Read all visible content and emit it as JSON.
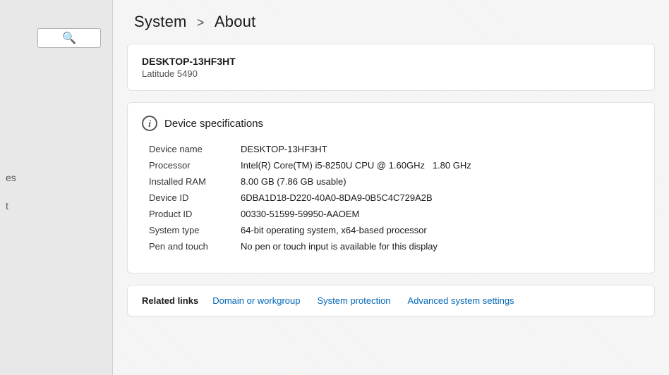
{
  "breadcrumb": {
    "parent": "System",
    "separator": ">",
    "current": "About"
  },
  "device_header": {
    "hostname": "DESKTOP-13HF3HT",
    "model": "Latitude 5490"
  },
  "specs_section": {
    "icon_label": "i",
    "title": "Device specifications",
    "rows": [
      {
        "label": "Device name",
        "value": "DESKTOP-13HF3HT"
      },
      {
        "label": "Processor",
        "value": "Intel(R) Core(TM) i5-8250U CPU @ 1.60GHz   1.80 GHz"
      },
      {
        "label": "Installed RAM",
        "value": "8.00 GB (7.86 GB usable)"
      },
      {
        "label": "Device ID",
        "value": "6DBA1D18-D220-40A0-8DA9-0B5C4C729A2B"
      },
      {
        "label": "Product ID",
        "value": "00330-51599-59950-AAOEM"
      },
      {
        "label": "System type",
        "value": "64-bit operating system, x64-based processor"
      },
      {
        "label": "Pen and touch",
        "value": "No pen or touch input is available for this display"
      }
    ]
  },
  "related_links": {
    "label": "Related links",
    "links": [
      "Domain or workgroup",
      "System protection",
      "Advanced system settings"
    ]
  },
  "sidebar": {
    "search_placeholder": "",
    "search_icon": "🔍",
    "items": [
      "es",
      "t"
    ]
  }
}
